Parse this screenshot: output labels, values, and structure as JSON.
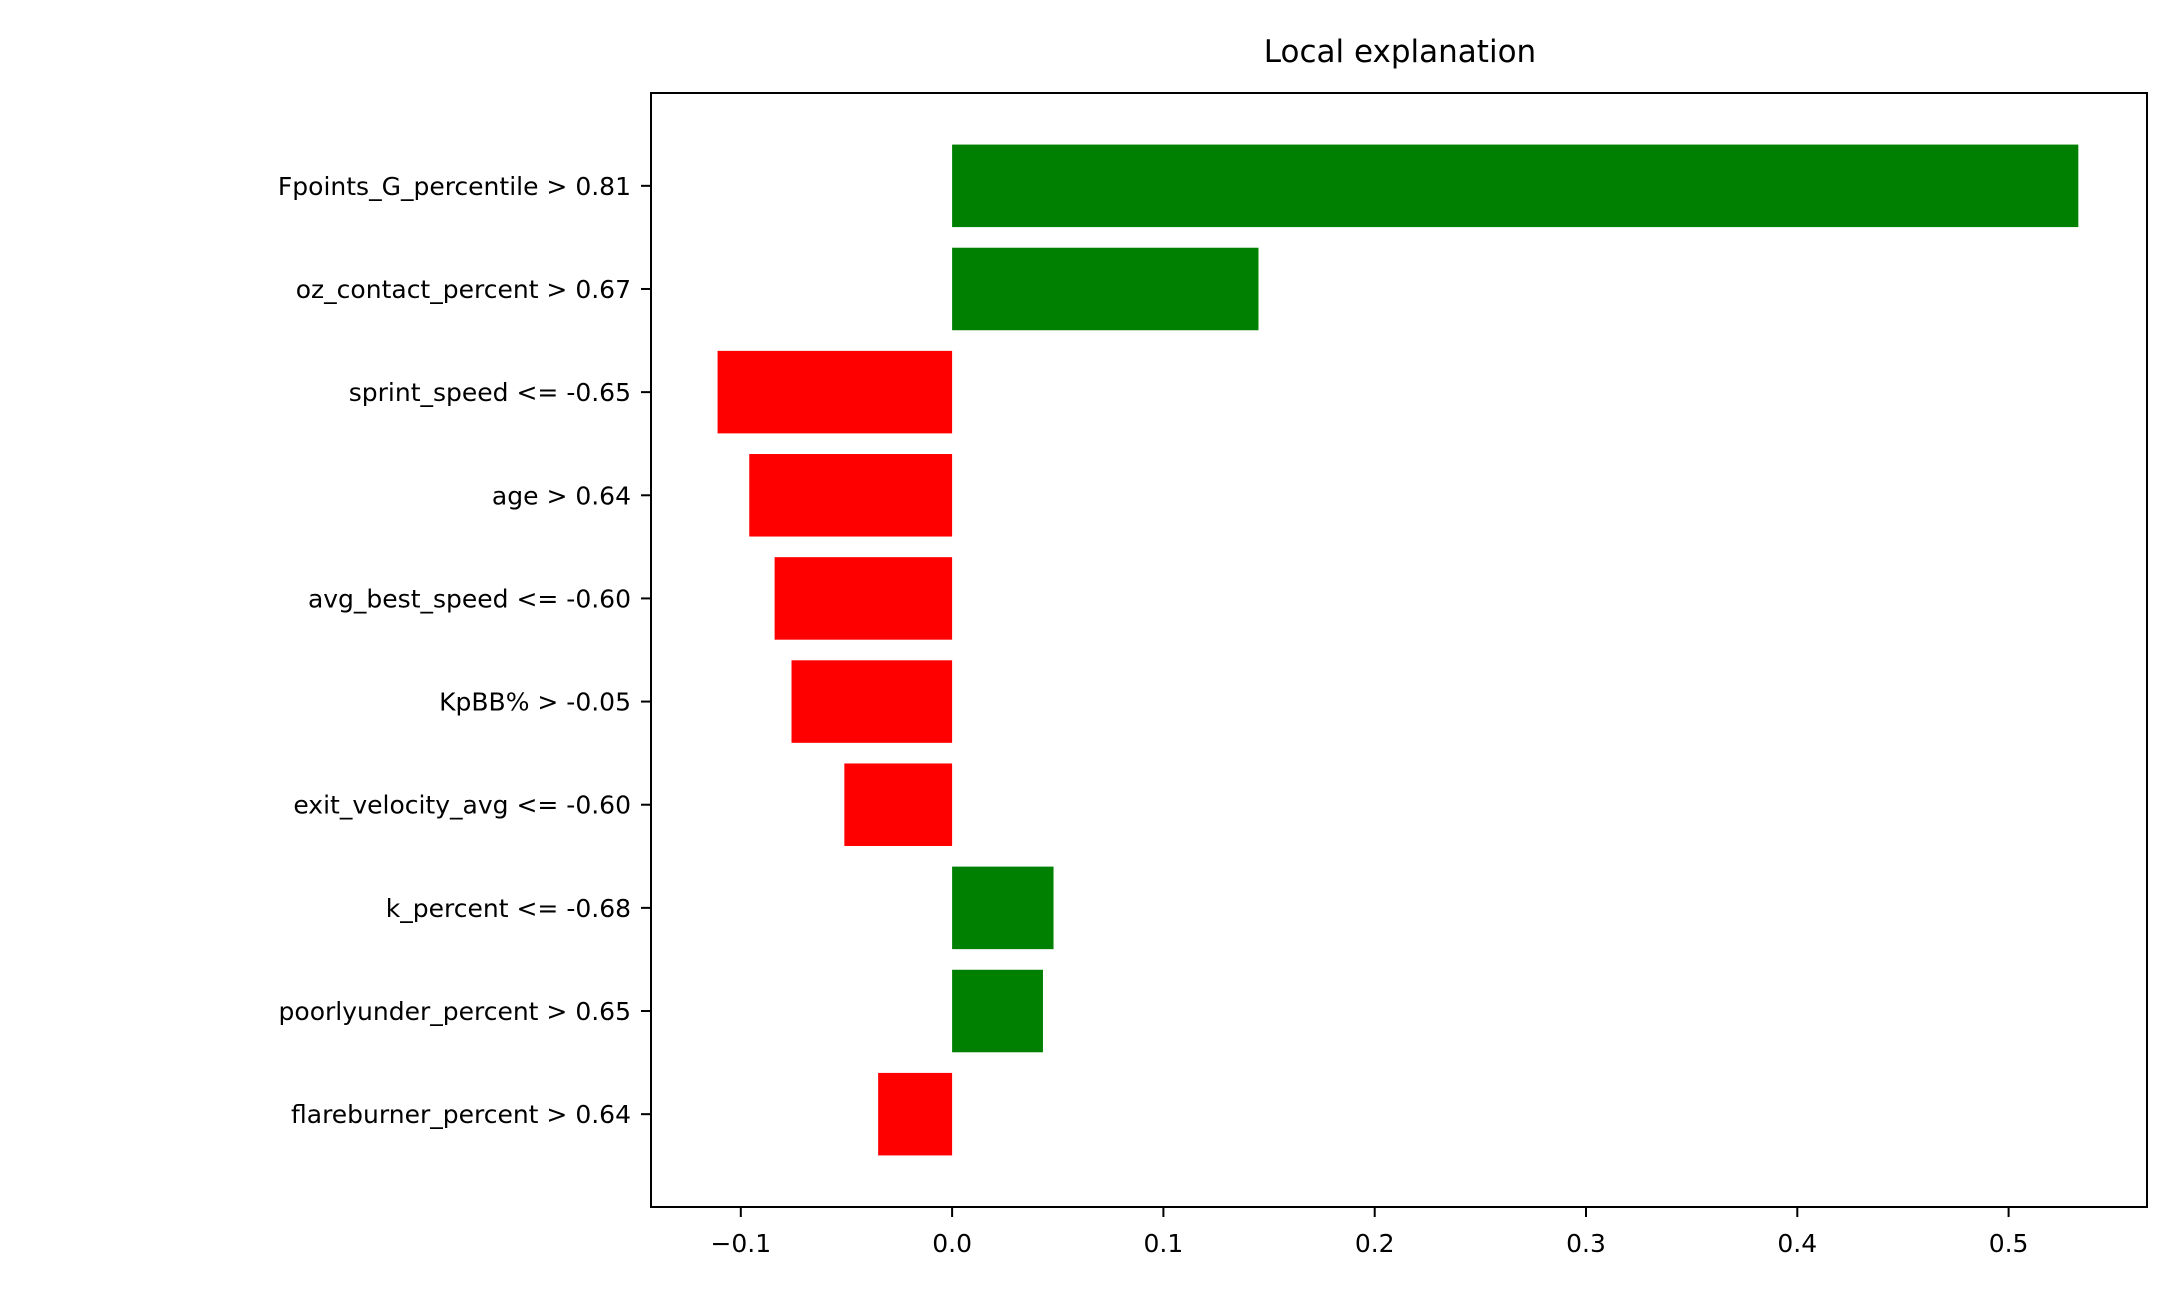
{
  "chart_data": {
    "type": "bar",
    "orientation": "horizontal",
    "title": "Local explanation",
    "xlabel": "",
    "ylabel": "",
    "xlim": [
      -0.1425,
      0.5655
    ],
    "xticks": [
      -0.1,
      0.0,
      0.1,
      0.2,
      0.3,
      0.4,
      0.5
    ],
    "xtick_labels": [
      "−0.1",
      "0.0",
      "0.1",
      "0.2",
      "0.3",
      "0.4",
      "0.5"
    ],
    "grid": false,
    "categories": [
      "Fpoints_G_percentile > 0.81",
      "oz_contact_percent > 0.67",
      "sprint_speed <= -0.65",
      "age > 0.64",
      "avg_best_speed <= -0.60",
      "KpBB% > -0.05",
      "exit_velocity_avg <= -0.60",
      "k_percent <= -0.68",
      "poorlyunder_percent > 0.65",
      "flareburner_percent > 0.64"
    ],
    "values": [
      0.533,
      0.145,
      -0.111,
      -0.096,
      -0.084,
      -0.076,
      -0.051,
      0.048,
      0.043,
      -0.035
    ],
    "colors": {
      "positive": "#008000",
      "negative": "#ff0000"
    }
  }
}
